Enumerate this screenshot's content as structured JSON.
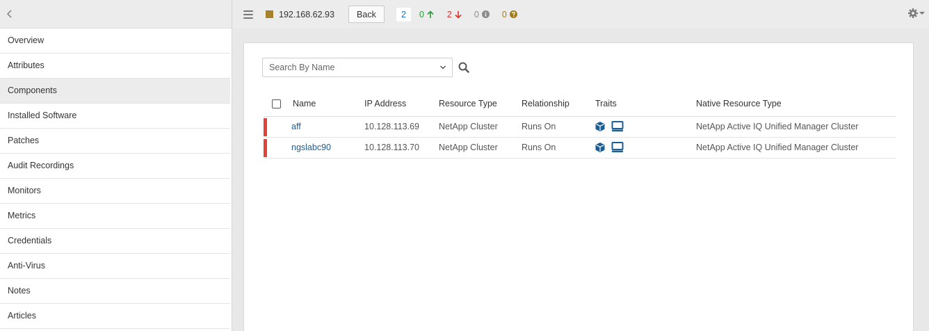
{
  "colors": {
    "status_square": "#a8822a",
    "down_status": "#e0433a",
    "link": "#1f5b94",
    "trait_icon": "#1b5e94"
  },
  "topbar": {
    "host": "192.168.62.93",
    "back_label": "Back",
    "total_count": "2",
    "up_count": "0",
    "down_count": "2",
    "info_count": "0",
    "unknown_count": "0"
  },
  "sidebar": {
    "items": [
      {
        "label": "Overview"
      },
      {
        "label": "Attributes"
      },
      {
        "label": "Components"
      },
      {
        "label": "Installed Software"
      },
      {
        "label": "Patches"
      },
      {
        "label": "Audit Recordings"
      },
      {
        "label": "Monitors"
      },
      {
        "label": "Metrics"
      },
      {
        "label": "Credentials"
      },
      {
        "label": "Anti-Virus"
      },
      {
        "label": "Notes"
      },
      {
        "label": "Articles"
      }
    ],
    "active": "Components"
  },
  "search": {
    "placeholder": "Search By Name"
  },
  "table": {
    "headers": {
      "name": "Name",
      "ip": "IP Address",
      "resource_type": "Resource Type",
      "relationship": "Relationship",
      "traits": "Traits",
      "native_type": "Native Resource Type"
    },
    "rows": [
      {
        "name": "aff",
        "ip": "10.128.113.69",
        "resource_type": "NetApp Cluster",
        "relationship": "Runs On",
        "traits": [
          "cube-icon",
          "monitor-icon"
        ],
        "native_type": "NetApp Active IQ Unified Manager Cluster"
      },
      {
        "name": "ngslabc90",
        "ip": "10.128.113.70",
        "resource_type": "NetApp Cluster",
        "relationship": "Runs On",
        "traits": [
          "cube-icon",
          "monitor-icon"
        ],
        "native_type": "NetApp Active IQ Unified Manager Cluster"
      }
    ]
  }
}
